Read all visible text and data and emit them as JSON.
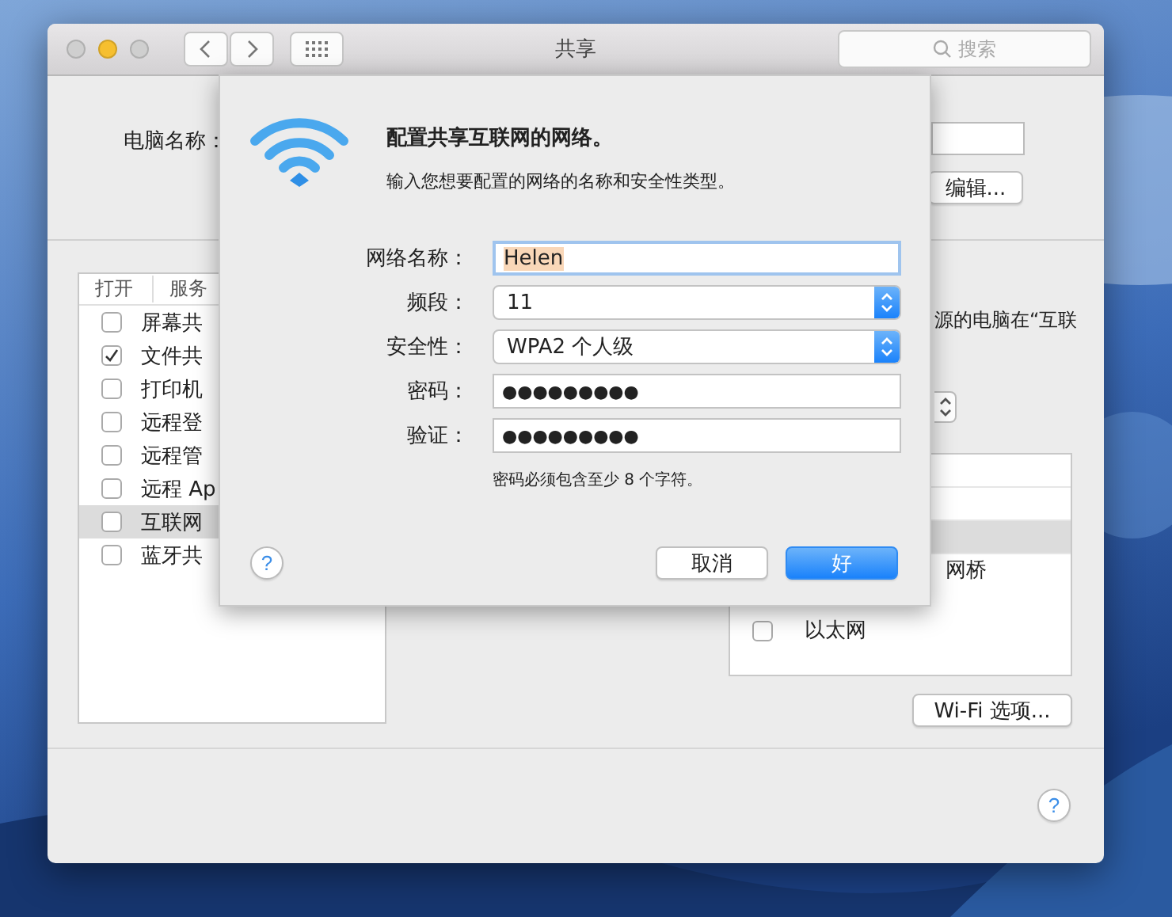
{
  "window": {
    "title": "共享",
    "search": {
      "placeholder": "搜索"
    }
  },
  "computer_name": {
    "label": "电脑名称：",
    "edit_button": "编辑..."
  },
  "services": {
    "columns": [
      "打开",
      "服务"
    ],
    "rows": [
      {
        "name": "屏幕共",
        "checked": false,
        "selected": false
      },
      {
        "name": "文件共",
        "checked": true,
        "selected": false
      },
      {
        "name": "打印机",
        "checked": false,
        "selected": false
      },
      {
        "name": "远程登",
        "checked": false,
        "selected": false
      },
      {
        "name": "远程管",
        "checked": false,
        "selected": false
      },
      {
        "name": "远程 Ap",
        "checked": false,
        "selected": false
      },
      {
        "name": "互联网",
        "checked": false,
        "selected": true
      },
      {
        "name": "蓝牙共",
        "checked": false,
        "selected": false
      }
    ]
  },
  "right_panel": {
    "description": "源的电脑在“互联",
    "interfaces": [
      {
        "kind": "blank",
        "selected": false
      },
      {
        "kind": "blank",
        "selected": false
      },
      {
        "kind": "blank",
        "selected": true
      },
      {
        "kind": "text",
        "label": "网桥",
        "selected": false
      },
      {
        "kind": "checkbox",
        "label": "以太网",
        "checked": false,
        "selected": false
      }
    ],
    "wifi_button": "Wi-Fi 选项..."
  },
  "sheet": {
    "title": "配置共享互联网的网络。",
    "subtitle": "输入您想要配置的网络的名称和安全性类型。",
    "fields": [
      {
        "kind": "text",
        "label": "网络名称：",
        "value": "Helen",
        "text_selected": true
      },
      {
        "kind": "popup",
        "label": "频段：",
        "value": "11"
      },
      {
        "kind": "popup",
        "label": "安全性：",
        "value": "WPA2 个人级"
      },
      {
        "kind": "password",
        "label": "密码：",
        "value": "●●●●●●●●●"
      },
      {
        "kind": "password",
        "label": "验证：",
        "value": "●●●●●●●●●"
      }
    ],
    "hint": "密码必须包含至少 8 个字符。",
    "help": "?",
    "cancel": "取消",
    "ok": "好"
  },
  "help": "?"
}
